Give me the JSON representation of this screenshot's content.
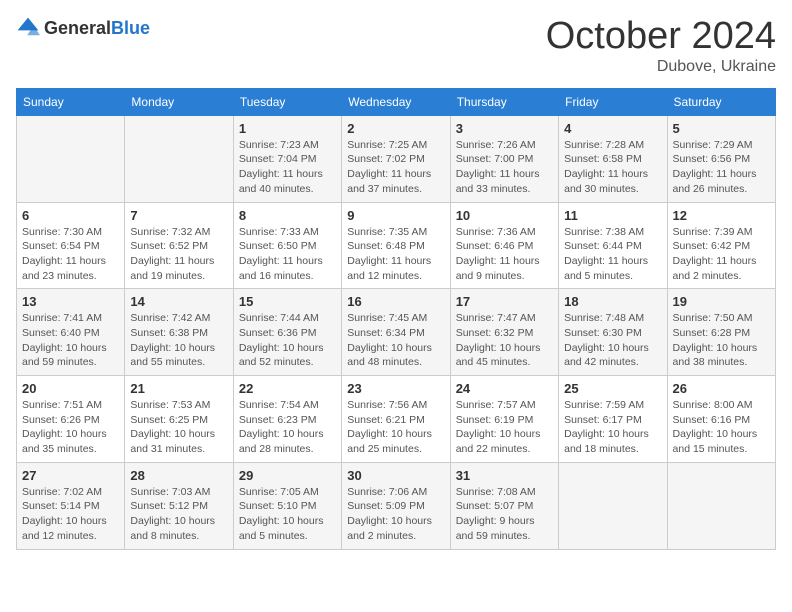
{
  "logo": {
    "general": "General",
    "blue": "Blue"
  },
  "header": {
    "month": "October 2024",
    "location": "Dubove, Ukraine"
  },
  "weekdays": [
    "Sunday",
    "Monday",
    "Tuesday",
    "Wednesday",
    "Thursday",
    "Friday",
    "Saturday"
  ],
  "weeks": [
    [
      {
        "day": "",
        "sunrise": "",
        "sunset": "",
        "daylight": ""
      },
      {
        "day": "",
        "sunrise": "",
        "sunset": "",
        "daylight": ""
      },
      {
        "day": "1",
        "sunrise": "Sunrise: 7:23 AM",
        "sunset": "Sunset: 7:04 PM",
        "daylight": "Daylight: 11 hours and 40 minutes."
      },
      {
        "day": "2",
        "sunrise": "Sunrise: 7:25 AM",
        "sunset": "Sunset: 7:02 PM",
        "daylight": "Daylight: 11 hours and 37 minutes."
      },
      {
        "day": "3",
        "sunrise": "Sunrise: 7:26 AM",
        "sunset": "Sunset: 7:00 PM",
        "daylight": "Daylight: 11 hours and 33 minutes."
      },
      {
        "day": "4",
        "sunrise": "Sunrise: 7:28 AM",
        "sunset": "Sunset: 6:58 PM",
        "daylight": "Daylight: 11 hours and 30 minutes."
      },
      {
        "day": "5",
        "sunrise": "Sunrise: 7:29 AM",
        "sunset": "Sunset: 6:56 PM",
        "daylight": "Daylight: 11 hours and 26 minutes."
      }
    ],
    [
      {
        "day": "6",
        "sunrise": "Sunrise: 7:30 AM",
        "sunset": "Sunset: 6:54 PM",
        "daylight": "Daylight: 11 hours and 23 minutes."
      },
      {
        "day": "7",
        "sunrise": "Sunrise: 7:32 AM",
        "sunset": "Sunset: 6:52 PM",
        "daylight": "Daylight: 11 hours and 19 minutes."
      },
      {
        "day": "8",
        "sunrise": "Sunrise: 7:33 AM",
        "sunset": "Sunset: 6:50 PM",
        "daylight": "Daylight: 11 hours and 16 minutes."
      },
      {
        "day": "9",
        "sunrise": "Sunrise: 7:35 AM",
        "sunset": "Sunset: 6:48 PM",
        "daylight": "Daylight: 11 hours and 12 minutes."
      },
      {
        "day": "10",
        "sunrise": "Sunrise: 7:36 AM",
        "sunset": "Sunset: 6:46 PM",
        "daylight": "Daylight: 11 hours and 9 minutes."
      },
      {
        "day": "11",
        "sunrise": "Sunrise: 7:38 AM",
        "sunset": "Sunset: 6:44 PM",
        "daylight": "Daylight: 11 hours and 5 minutes."
      },
      {
        "day": "12",
        "sunrise": "Sunrise: 7:39 AM",
        "sunset": "Sunset: 6:42 PM",
        "daylight": "Daylight: 11 hours and 2 minutes."
      }
    ],
    [
      {
        "day": "13",
        "sunrise": "Sunrise: 7:41 AM",
        "sunset": "Sunset: 6:40 PM",
        "daylight": "Daylight: 10 hours and 59 minutes."
      },
      {
        "day": "14",
        "sunrise": "Sunrise: 7:42 AM",
        "sunset": "Sunset: 6:38 PM",
        "daylight": "Daylight: 10 hours and 55 minutes."
      },
      {
        "day": "15",
        "sunrise": "Sunrise: 7:44 AM",
        "sunset": "Sunset: 6:36 PM",
        "daylight": "Daylight: 10 hours and 52 minutes."
      },
      {
        "day": "16",
        "sunrise": "Sunrise: 7:45 AM",
        "sunset": "Sunset: 6:34 PM",
        "daylight": "Daylight: 10 hours and 48 minutes."
      },
      {
        "day": "17",
        "sunrise": "Sunrise: 7:47 AM",
        "sunset": "Sunset: 6:32 PM",
        "daylight": "Daylight: 10 hours and 45 minutes."
      },
      {
        "day": "18",
        "sunrise": "Sunrise: 7:48 AM",
        "sunset": "Sunset: 6:30 PM",
        "daylight": "Daylight: 10 hours and 42 minutes."
      },
      {
        "day": "19",
        "sunrise": "Sunrise: 7:50 AM",
        "sunset": "Sunset: 6:28 PM",
        "daylight": "Daylight: 10 hours and 38 minutes."
      }
    ],
    [
      {
        "day": "20",
        "sunrise": "Sunrise: 7:51 AM",
        "sunset": "Sunset: 6:26 PM",
        "daylight": "Daylight: 10 hours and 35 minutes."
      },
      {
        "day": "21",
        "sunrise": "Sunrise: 7:53 AM",
        "sunset": "Sunset: 6:25 PM",
        "daylight": "Daylight: 10 hours and 31 minutes."
      },
      {
        "day": "22",
        "sunrise": "Sunrise: 7:54 AM",
        "sunset": "Sunset: 6:23 PM",
        "daylight": "Daylight: 10 hours and 28 minutes."
      },
      {
        "day": "23",
        "sunrise": "Sunrise: 7:56 AM",
        "sunset": "Sunset: 6:21 PM",
        "daylight": "Daylight: 10 hours and 25 minutes."
      },
      {
        "day": "24",
        "sunrise": "Sunrise: 7:57 AM",
        "sunset": "Sunset: 6:19 PM",
        "daylight": "Daylight: 10 hours and 22 minutes."
      },
      {
        "day": "25",
        "sunrise": "Sunrise: 7:59 AM",
        "sunset": "Sunset: 6:17 PM",
        "daylight": "Daylight: 10 hours and 18 minutes."
      },
      {
        "day": "26",
        "sunrise": "Sunrise: 8:00 AM",
        "sunset": "Sunset: 6:16 PM",
        "daylight": "Daylight: 10 hours and 15 minutes."
      }
    ],
    [
      {
        "day": "27",
        "sunrise": "Sunrise: 7:02 AM",
        "sunset": "Sunset: 5:14 PM",
        "daylight": "Daylight: 10 hours and 12 minutes."
      },
      {
        "day": "28",
        "sunrise": "Sunrise: 7:03 AM",
        "sunset": "Sunset: 5:12 PM",
        "daylight": "Daylight: 10 hours and 8 minutes."
      },
      {
        "day": "29",
        "sunrise": "Sunrise: 7:05 AM",
        "sunset": "Sunset: 5:10 PM",
        "daylight": "Daylight: 10 hours and 5 minutes."
      },
      {
        "day": "30",
        "sunrise": "Sunrise: 7:06 AM",
        "sunset": "Sunset: 5:09 PM",
        "daylight": "Daylight: 10 hours and 2 minutes."
      },
      {
        "day": "31",
        "sunrise": "Sunrise: 7:08 AM",
        "sunset": "Sunset: 5:07 PM",
        "daylight": "Daylight: 9 hours and 59 minutes."
      },
      {
        "day": "",
        "sunrise": "",
        "sunset": "",
        "daylight": ""
      },
      {
        "day": "",
        "sunrise": "",
        "sunset": "",
        "daylight": ""
      }
    ]
  ]
}
